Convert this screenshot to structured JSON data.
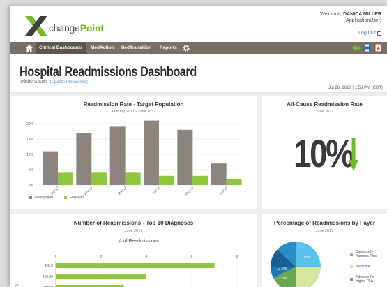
{
  "header": {
    "logo_x": "X",
    "logo_change": "change",
    "logo_point": "Point",
    "welcome_prefix": "Welcome,",
    "welcome_user": "DANICA MILLER",
    "welcome_role": "[ ApplicationUser]",
    "logout_label": "Log Out"
  },
  "nav": {
    "items": [
      {
        "label": "Clinical Dashboards",
        "active": true
      },
      {
        "label": "MedAction",
        "active": false
      },
      {
        "label": "MedTransition",
        "active": false
      },
      {
        "label": "Reports",
        "active": false
      }
    ],
    "icons": [
      "home-icon",
      "gear-icon",
      "back-arrow-icon",
      "print-icon",
      "pdf-icon"
    ]
  },
  "page": {
    "title": "Hospital Readmissions Dashboard",
    "facility": "Trinity South",
    "update_link": "[Update Preference]",
    "timestamp": "Jul 28, 2017 | 1:53 PM (CDT)"
  },
  "colors": {
    "brand_green": "#7ab62a",
    "nav_bg": "#7a6f63",
    "unengaged": "#8c857d",
    "engaged": "#8dc63f",
    "arrow_green": "#6fba2c"
  },
  "panels": {
    "readmission_rate": {
      "title": "Readmission Rate - Target Population",
      "subtitle": "January 2017 - June 2017"
    },
    "all_cause": {
      "title": "All-Cause Readmission Rate",
      "subtitle": "June 2017",
      "value": "10%",
      "trend": "down"
    },
    "top10": {
      "title": "Number of Readmissions - Top 10 Diagnoses",
      "subtitle": "June 2017",
      "axis_title": "# of Readmissions",
      "y_axis_label": "ICD"
    },
    "by_payer": {
      "title": "Percentage of Readmissions by Payer",
      "subtitle": "June 2017",
      "slice_labels": [
        "25%",
        "12.5%",
        "12.5%"
      ],
      "legend": [
        {
          "label": "Caresius D Humana Plus",
          "color": "#5bc0eb"
        },
        {
          "label": "Medicare",
          "color": "#d4e8a0"
        },
        {
          "label": "Advance Fo Higoni Plus",
          "color": "#6aa84f"
        }
      ]
    }
  },
  "chart_data": [
    {
      "type": "bar",
      "title": "Readmission Rate - Target Population",
      "subtitle": "January 2017 - June 2017",
      "categories": [
        "Jan'17",
        "Feb'17",
        "Mar'17",
        "Apr'17",
        "May'17",
        "Jun'17"
      ],
      "series": [
        {
          "name": "Unengaged",
          "values": [
            11,
            17,
            19,
            21,
            18,
            7
          ]
        },
        {
          "name": "Engaged",
          "values": [
            4,
            4,
            4,
            3,
            3,
            2
          ]
        }
      ],
      "yticks": [
        "0%",
        "5%",
        "10%",
        "15%",
        "20%"
      ],
      "ylim": [
        0,
        20
      ],
      "grid": true,
      "legend": "bottom-left"
    },
    {
      "type": "bar",
      "orientation": "horizontal",
      "title": "Number of Readmissions - Top 10 Diagnoses",
      "subtitle": "June 2017",
      "xlabel": "# of Readmissions",
      "ylabel": "ICD",
      "categories": [
        "428.0",
        "410.00",
        "486[2]"
      ],
      "values": [
        7,
        4,
        3
      ],
      "xticks": [
        "0",
        "2",
        "4",
        "6",
        "8"
      ],
      "xlim": [
        0,
        8
      ]
    },
    {
      "type": "pie",
      "title": "Percentage of Readmissions by Payer",
      "subtitle": "June 2017",
      "slices": [
        {
          "label": "Caresius D Humana Plus",
          "value": 25
        },
        {
          "value": 12.5
        },
        {
          "value": 12.5
        }
      ],
      "legend": "right"
    }
  ]
}
